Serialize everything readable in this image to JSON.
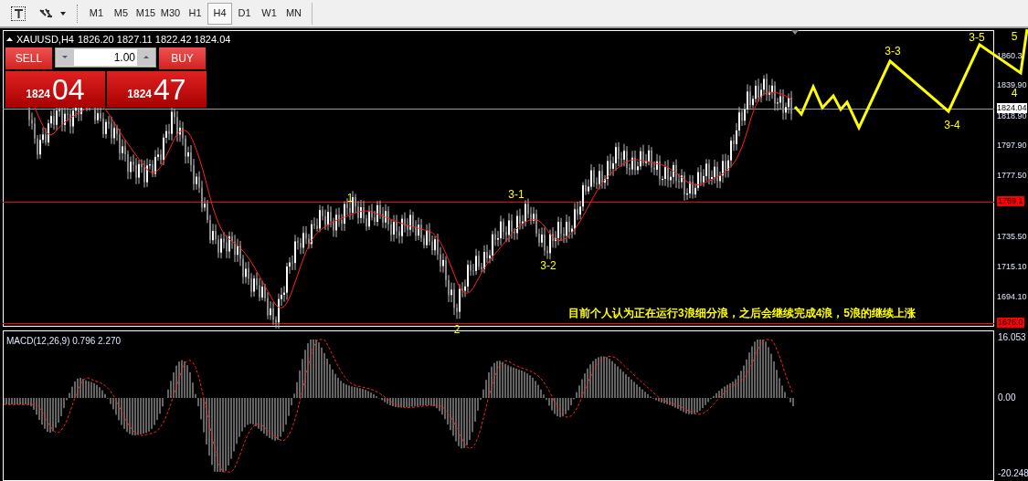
{
  "toolbar": {
    "timeframes": [
      {
        "label": "M1",
        "selected": false
      },
      {
        "label": "M5",
        "selected": false
      },
      {
        "label": "M15",
        "selected": false
      },
      {
        "label": "M30",
        "selected": false
      },
      {
        "label": "H1",
        "selected": false
      },
      {
        "label": "H4",
        "selected": true
      },
      {
        "label": "D1",
        "selected": false
      },
      {
        "label": "W1",
        "selected": false
      },
      {
        "label": "MN",
        "selected": false
      }
    ]
  },
  "chart": {
    "symbol": "XAUUSD,H4",
    "ohlc": "1826.20 1827.11 1822.42 1824.04",
    "trade_panel": {
      "sell_label": "SELL",
      "buy_label": "BUY",
      "lot": "1.00",
      "sell_price": {
        "prefix": "1824",
        "digits": "04"
      },
      "buy_price": {
        "prefix": "1824",
        "digits": "47"
      }
    },
    "price_axis": [
      {
        "label": "1860.3",
        "kind": "tick"
      },
      {
        "label": "1839.90",
        "kind": "tick"
      },
      {
        "label": "1824.04",
        "kind": "current"
      },
      {
        "label": "1818.90",
        "kind": "tick"
      },
      {
        "label": "1797.90",
        "kind": "tick"
      },
      {
        "label": "1777.50",
        "kind": "tick"
      },
      {
        "label": "1759.1",
        "kind": "level"
      },
      {
        "label": "1735.50",
        "kind": "tick"
      },
      {
        "label": "1715.10",
        "kind": "tick"
      },
      {
        "label": "1694.10",
        "kind": "tick"
      },
      {
        "label": "1676.0",
        "kind": "level"
      }
    ],
    "wave_labels": [
      "1",
      "3-1",
      "3-2",
      "2",
      "3-3",
      "3-4",
      "3-5",
      "5",
      "4"
    ],
    "note": "目前个人认为正在运行3浪细分浪，之后会继续完成4浪，5浪的继续上涨"
  },
  "indicator": {
    "title": "MACD(12,26,9) 0.796 2.270",
    "axis": [
      "16.053",
      "0.00",
      "-20.248"
    ]
  }
}
